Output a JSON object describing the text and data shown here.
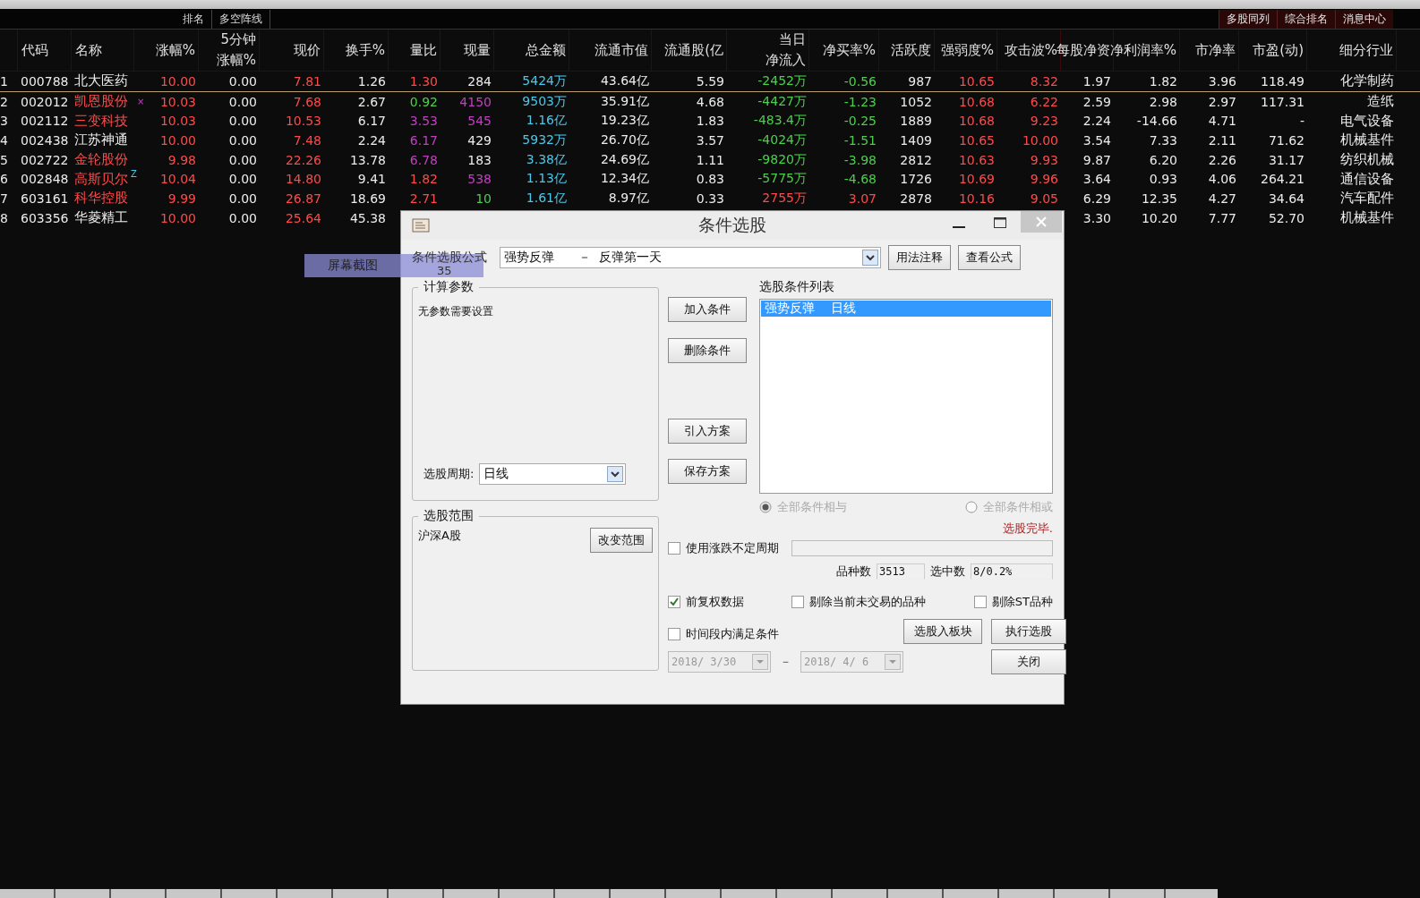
{
  "toolbar": {
    "items": [
      "排名",
      "多空阵线"
    ],
    "right_items": [
      "多股同列",
      "综合排名",
      "消息中心"
    ]
  },
  "table": {
    "columns": [
      {},
      {
        "label": "代码"
      },
      {
        "label": "名称"
      },
      {
        "label": "涨幅%"
      },
      {
        "label": "5分钟",
        "sub": "涨幅%"
      },
      {
        "label": "现价"
      },
      {
        "label": "换手%"
      },
      {
        "label": "量比"
      },
      {
        "label": "现量"
      },
      {
        "label": "总金额"
      },
      {
        "label": "流通市值"
      },
      {
        "label": "流通股(亿"
      },
      {
        "label": "当日",
        "sub": "净流入"
      },
      {
        "label": "净买率%"
      },
      {
        "label": "活跃度"
      },
      {
        "label": "强弱度%"
      },
      {
        "label": "攻击波%"
      },
      {
        "label": "每股净资"
      },
      {
        "label": "净利润率%"
      },
      {
        "label": "市净率"
      },
      {
        "label": "市盈(动)"
      },
      {
        "label": "细分行业"
      }
    ],
    "rows": [
      {
        "selected": true,
        "cells": [
          {
            "text": "1"
          },
          {
            "text": "000788"
          },
          {
            "text": "北大医药"
          },
          {
            "text": "10.00",
            "color": "#ff4a4a"
          },
          {
            "text": "0.00"
          },
          {
            "text": "7.81",
            "color": "#ff4a4a"
          },
          {
            "text": "1.26"
          },
          {
            "text": "1.30",
            "color": "#ff4a4a"
          },
          {
            "text": "284"
          },
          {
            "text": "5424万",
            "color": "#4cc8e8"
          },
          {
            "text": "43.64亿"
          },
          {
            "text": "5.59"
          },
          {
            "text": "-2452万",
            "color": "#4cd04c"
          },
          {
            "text": "-0.56",
            "color": "#4cd04c"
          },
          {
            "text": "987"
          },
          {
            "text": "10.65",
            "color": "#ff4a4a"
          },
          {
            "text": "8.32",
            "color": "#ff4a4a"
          },
          {
            "text": "1.97"
          },
          {
            "text": "1.82"
          },
          {
            "text": "3.96"
          },
          {
            "text": "118.49"
          },
          {
            "text": "化学制药"
          }
        ]
      },
      {
        "selected": false,
        "cells": [
          {
            "text": "2"
          },
          {
            "text": "002012"
          },
          {
            "text": "凯恩股份",
            "color": "#ff4a4a"
          },
          {
            "text": "10.03",
            "color": "#ff4a4a",
            "mark": "×"
          },
          {
            "text": "0.00"
          },
          {
            "text": "7.68",
            "color": "#ff4a4a"
          },
          {
            "text": "2.67"
          },
          {
            "text": "0.92",
            "color": "#4cd04c"
          },
          {
            "text": "4150",
            "color": "#c040c0"
          },
          {
            "text": "9503万",
            "color": "#4cc8e8"
          },
          {
            "text": "35.91亿"
          },
          {
            "text": "4.68"
          },
          {
            "text": "-4427万",
            "color": "#4cd04c"
          },
          {
            "text": "-1.23",
            "color": "#4cd04c"
          },
          {
            "text": "1052"
          },
          {
            "text": "10.68",
            "color": "#ff4a4a"
          },
          {
            "text": "6.22",
            "color": "#ff4a4a"
          },
          {
            "text": "2.59"
          },
          {
            "text": "2.98"
          },
          {
            "text": "2.97"
          },
          {
            "text": "117.31"
          },
          {
            "text": "造纸"
          }
        ]
      },
      {
        "selected": false,
        "cells": [
          {
            "text": "3"
          },
          {
            "text": "002112"
          },
          {
            "text": "三变科技",
            "color": "#ff4a4a"
          },
          {
            "text": "10.03",
            "color": "#ff4a4a"
          },
          {
            "text": "0.00"
          },
          {
            "text": "10.53",
            "color": "#ff4a4a"
          },
          {
            "text": "6.17"
          },
          {
            "text": "3.53",
            "color": "#c040c0"
          },
          {
            "text": "545",
            "color": "#c040c0"
          },
          {
            "text": "1.16亿",
            "color": "#4cc8e8"
          },
          {
            "text": "19.23亿"
          },
          {
            "text": "1.83"
          },
          {
            "text": "-483.4万",
            "color": "#4cd04c"
          },
          {
            "text": "-0.25",
            "color": "#4cd04c"
          },
          {
            "text": "1889"
          },
          {
            "text": "10.68",
            "color": "#ff4a4a"
          },
          {
            "text": "9.23",
            "color": "#ff4a4a"
          },
          {
            "text": "2.24"
          },
          {
            "text": "-14.66"
          },
          {
            "text": "4.71"
          },
          {
            "text": "-"
          },
          {
            "text": "电气设备"
          }
        ]
      },
      {
        "selected": false,
        "cells": [
          {
            "text": "4"
          },
          {
            "text": "002438"
          },
          {
            "text": "江苏神通"
          },
          {
            "text": "10.00",
            "color": "#ff4a4a"
          },
          {
            "text": "0.00"
          },
          {
            "text": "7.48",
            "color": "#ff4a4a"
          },
          {
            "text": "2.24"
          },
          {
            "text": "6.17",
            "color": "#c040c0"
          },
          {
            "text": "429"
          },
          {
            "text": "5932万",
            "color": "#4cc8e8"
          },
          {
            "text": "26.70亿"
          },
          {
            "text": "3.57"
          },
          {
            "text": "-4024万",
            "color": "#4cd04c"
          },
          {
            "text": "-1.51",
            "color": "#4cd04c"
          },
          {
            "text": "1409"
          },
          {
            "text": "10.65",
            "color": "#ff4a4a"
          },
          {
            "text": "10.00",
            "color": "#ff4a4a"
          },
          {
            "text": "3.54"
          },
          {
            "text": "7.33"
          },
          {
            "text": "2.11"
          },
          {
            "text": "71.62"
          },
          {
            "text": "机械基件"
          }
        ]
      },
      {
        "selected": false,
        "cells": [
          {
            "text": "5"
          },
          {
            "text": "002722"
          },
          {
            "text": "金轮股份",
            "color": "#ff4a4a"
          },
          {
            "text": "9.98",
            "color": "#ff4a4a"
          },
          {
            "text": "0.00"
          },
          {
            "text": "22.26",
            "color": "#ff4a4a"
          },
          {
            "text": "13.78"
          },
          {
            "text": "6.78",
            "color": "#c040c0"
          },
          {
            "text": "183"
          },
          {
            "text": "3.38亿",
            "color": "#4cc8e8"
          },
          {
            "text": "24.69亿"
          },
          {
            "text": "1.11"
          },
          {
            "text": "-9820万",
            "color": "#4cd04c"
          },
          {
            "text": "-3.98",
            "color": "#4cd04c"
          },
          {
            "text": "2812"
          },
          {
            "text": "10.63",
            "color": "#ff4a4a"
          },
          {
            "text": "9.93",
            "color": "#ff4a4a"
          },
          {
            "text": "9.87"
          },
          {
            "text": "6.20"
          },
          {
            "text": "2.26"
          },
          {
            "text": "31.17"
          },
          {
            "text": "纺织机械"
          }
        ]
      },
      {
        "selected": false,
        "cells": [
          {
            "text": "6"
          },
          {
            "text": "002848"
          },
          {
            "text": "高斯贝尔",
            "color": "#ff4a4a",
            "mark": "Z"
          },
          {
            "text": "10.04",
            "color": "#ff4a4a"
          },
          {
            "text": "0.00"
          },
          {
            "text": "14.80",
            "color": "#ff4a4a"
          },
          {
            "text": "9.41"
          },
          {
            "text": "1.82",
            "color": "#ff4a4a"
          },
          {
            "text": "538",
            "color": "#c040c0"
          },
          {
            "text": "1.13亿",
            "color": "#4cc8e8"
          },
          {
            "text": "12.34亿"
          },
          {
            "text": "0.83"
          },
          {
            "text": "-5775万",
            "color": "#4cd04c"
          },
          {
            "text": "-4.68",
            "color": "#4cd04c"
          },
          {
            "text": "1726"
          },
          {
            "text": "10.69",
            "color": "#ff4a4a"
          },
          {
            "text": "9.96",
            "color": "#ff4a4a"
          },
          {
            "text": "3.64"
          },
          {
            "text": "0.93"
          },
          {
            "text": "4.06"
          },
          {
            "text": "264.21"
          },
          {
            "text": "通信设备"
          }
        ]
      },
      {
        "selected": false,
        "cells": [
          {
            "text": "7"
          },
          {
            "text": "603161"
          },
          {
            "text": "科华控股",
            "color": "#ff4a4a"
          },
          {
            "text": "9.99",
            "color": "#ff4a4a"
          },
          {
            "text": "0.00"
          },
          {
            "text": "26.87",
            "color": "#ff4a4a"
          },
          {
            "text": "18.69"
          },
          {
            "text": "2.71",
            "color": "#ff4a4a"
          },
          {
            "text": "10",
            "color": "#4cd04c"
          },
          {
            "text": "1.61亿",
            "color": "#4cc8e8"
          },
          {
            "text": "8.97亿"
          },
          {
            "text": "0.33"
          },
          {
            "text": "2755万",
            "color": "#ff4a4a"
          },
          {
            "text": "3.07",
            "color": "#ff4a4a"
          },
          {
            "text": "2878"
          },
          {
            "text": "10.16",
            "color": "#ff4a4a"
          },
          {
            "text": "9.05",
            "color": "#ff4a4a"
          },
          {
            "text": "6.29"
          },
          {
            "text": "12.35"
          },
          {
            "text": "4.27"
          },
          {
            "text": "34.64"
          },
          {
            "text": "汽车配件"
          }
        ]
      },
      {
        "selected": false,
        "cells": [
          {
            "text": "8"
          },
          {
            "text": "603356"
          },
          {
            "text": "华菱精工"
          },
          {
            "text": "10.00",
            "color": "#ff4a4a"
          },
          {
            "text": "0.00"
          },
          {
            "text": "25.64",
            "color": "#ff4a4a"
          },
          {
            "text": "45.38"
          },
          null,
          null,
          null,
          null,
          null,
          null,
          null,
          null,
          null,
          null,
          {
            "text": "3.30"
          },
          {
            "text": "10.20"
          },
          {
            "text": "7.77"
          },
          {
            "text": "52.70"
          },
          {
            "text": "机械基件"
          }
        ]
      }
    ]
  },
  "screen_tip": {
    "label": "屏幕截图",
    "value": "35"
  },
  "dialog": {
    "title": "条件选股",
    "formula": {
      "label": "条件选股公式",
      "value": "强势反弹      －  反弹第一天"
    },
    "top_buttons": [
      "用法注释",
      "查看公式"
    ],
    "params_group": {
      "title": "计算参数",
      "note": "无参数需要设置",
      "period_label": "选股周期:",
      "period_value": "日线"
    },
    "scope_group": {
      "title": "选股范围",
      "value": "沪深A股",
      "button": "改变范围"
    },
    "action_buttons": [
      "加入条件",
      "删除条件",
      "引入方案",
      "保存方案"
    ],
    "condition_list": {
      "title": "选股条件列表",
      "items": [
        {
          "text": "强势反弹    日线",
          "selected": true
        }
      ]
    },
    "logic_disabled": true,
    "logic_options": [
      {
        "label": "全部条件相与",
        "selected": true
      },
      {
        "label": "全部条件相或",
        "selected": false
      }
    ],
    "status": "选股完毕.",
    "variable_period": {
      "label": "使用涨跌不定周期",
      "checked": false
    },
    "count": {
      "label": "品种数",
      "value": "3513"
    },
    "selected_count": {
      "label": "选中数",
      "value": "8/0.2%"
    },
    "options": [
      {
        "label": "前复权数据",
        "checked": true
      },
      {
        "label": "剔除当前未交易的品种",
        "checked": false
      },
      {
        "label": "剔除ST品种",
        "checked": false
      }
    ],
    "time_range": {
      "label": "时间段内满足条件",
      "checked": false,
      "start": "2018/ 3/30",
      "separator": "－",
      "end": "2018/ 4/ 6"
    },
    "bottom_buttons": [
      "选股入板块",
      "执行选股",
      "关闭"
    ]
  }
}
